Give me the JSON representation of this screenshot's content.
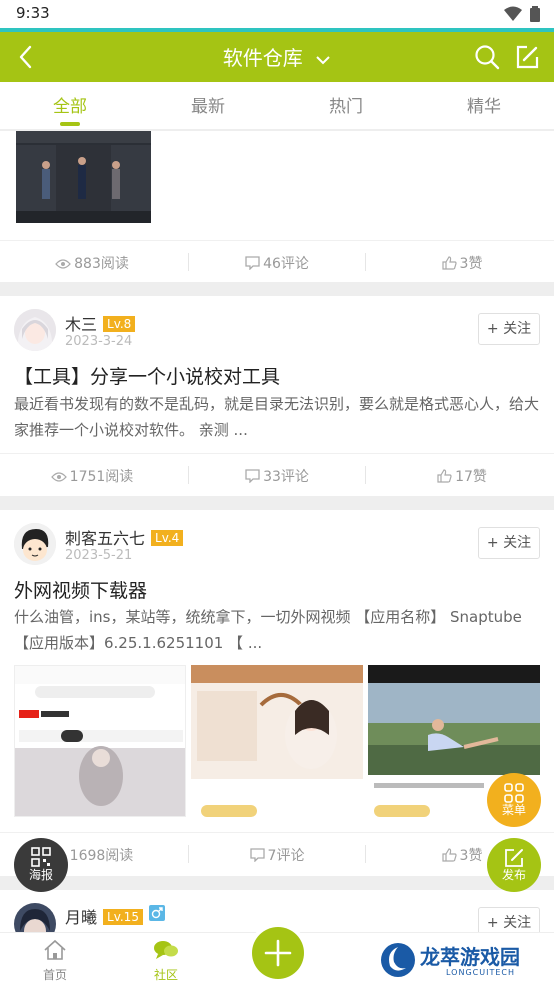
{
  "status_bar": {
    "time": "9:33"
  },
  "header": {
    "title": "软件仓库"
  },
  "tabs": [
    {
      "label": "全部",
      "active": true
    },
    {
      "label": "最新",
      "active": false
    },
    {
      "label": "热门",
      "active": false
    },
    {
      "label": "精华",
      "active": false
    }
  ],
  "posts": [
    {
      "stats": {
        "reads": "883阅读",
        "comments": "46评论",
        "likes": "3赞"
      }
    },
    {
      "user": "木三",
      "level": "Lv.8",
      "date": "2023-3-24",
      "follow": "+ 关注",
      "title": "【工具】分享一个小说校对工具",
      "body": "最近看书发现有的数不是乱码，就是目录无法识别，要么就是格式恶心人，给大家推荐一个小说校对软件。 亲测 ...",
      "stats": {
        "reads": "1751阅读",
        "comments": "33评论",
        "likes": "17赞"
      }
    },
    {
      "user": "刺客五六七",
      "level": "Lv.4",
      "date": "2023-5-21",
      "follow": "+ 关注",
      "title": "外网视频下载器",
      "body": "什么油管，ins，某站等，统统拿下，一切外网视频 【应用名称】 Snaptube 【应用版本】6.25.1.6251101 【 ...",
      "stats": {
        "reads": "1698阅读",
        "comments": "7评论",
        "likes": "3赞"
      }
    },
    {
      "user": "月曦",
      "level": "Lv.15",
      "follow": "+ 关注"
    }
  ],
  "fabs": {
    "menu": "菜单",
    "publish": "发布",
    "poster": "海报"
  },
  "bottom_nav": [
    {
      "label": "首页",
      "icon": "home-icon"
    },
    {
      "label": "社区",
      "icon": "community-icon",
      "active": true
    }
  ],
  "watermark": {
    "brand": "龙萃游戏园",
    "sub": "LONGCUITECH"
  },
  "colors": {
    "brand": "#a5c414",
    "accent_line": "#2ec4c0",
    "level_badge": "#f2b01e",
    "fab_orange": "#f2b01e"
  }
}
